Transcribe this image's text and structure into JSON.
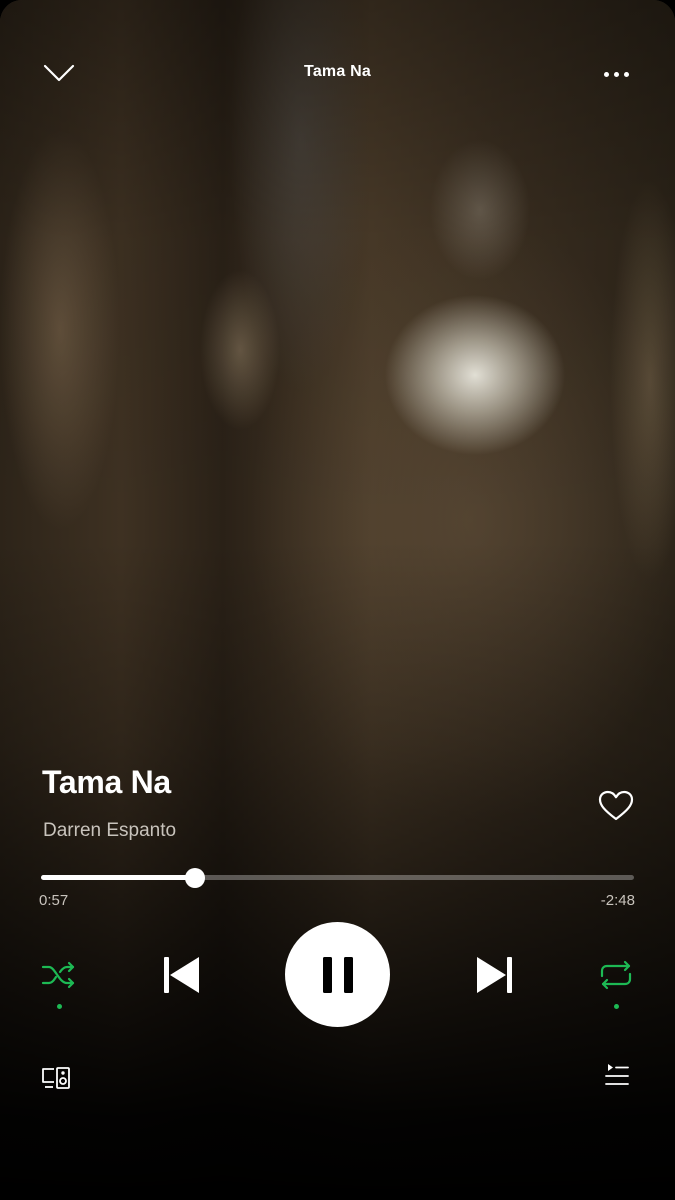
{
  "header": {
    "title": "Tama Na",
    "collapse_icon": "chevron-down-icon",
    "more_icon": "more-options-icon"
  },
  "track": {
    "title": "Tama Na",
    "artist": "Darren Espanto",
    "liked": false
  },
  "progress": {
    "elapsed": "0:57",
    "remaining": "-2:48",
    "fraction": 0.26
  },
  "controls": {
    "shuffle": {
      "icon": "shuffle-icon",
      "active": true
    },
    "previous": {
      "icon": "skip-previous-icon"
    },
    "play_pause": {
      "icon": "pause-icon",
      "state": "playing"
    },
    "next": {
      "icon": "skip-next-icon"
    },
    "repeat": {
      "icon": "repeat-icon",
      "active": true
    }
  },
  "bottom": {
    "devices_icon": "connect-devices-icon",
    "queue_icon": "queue-icon"
  },
  "colors": {
    "accent_green": "#1db954",
    "text_primary": "#ffffff",
    "text_secondary": "#c8c3bc"
  }
}
